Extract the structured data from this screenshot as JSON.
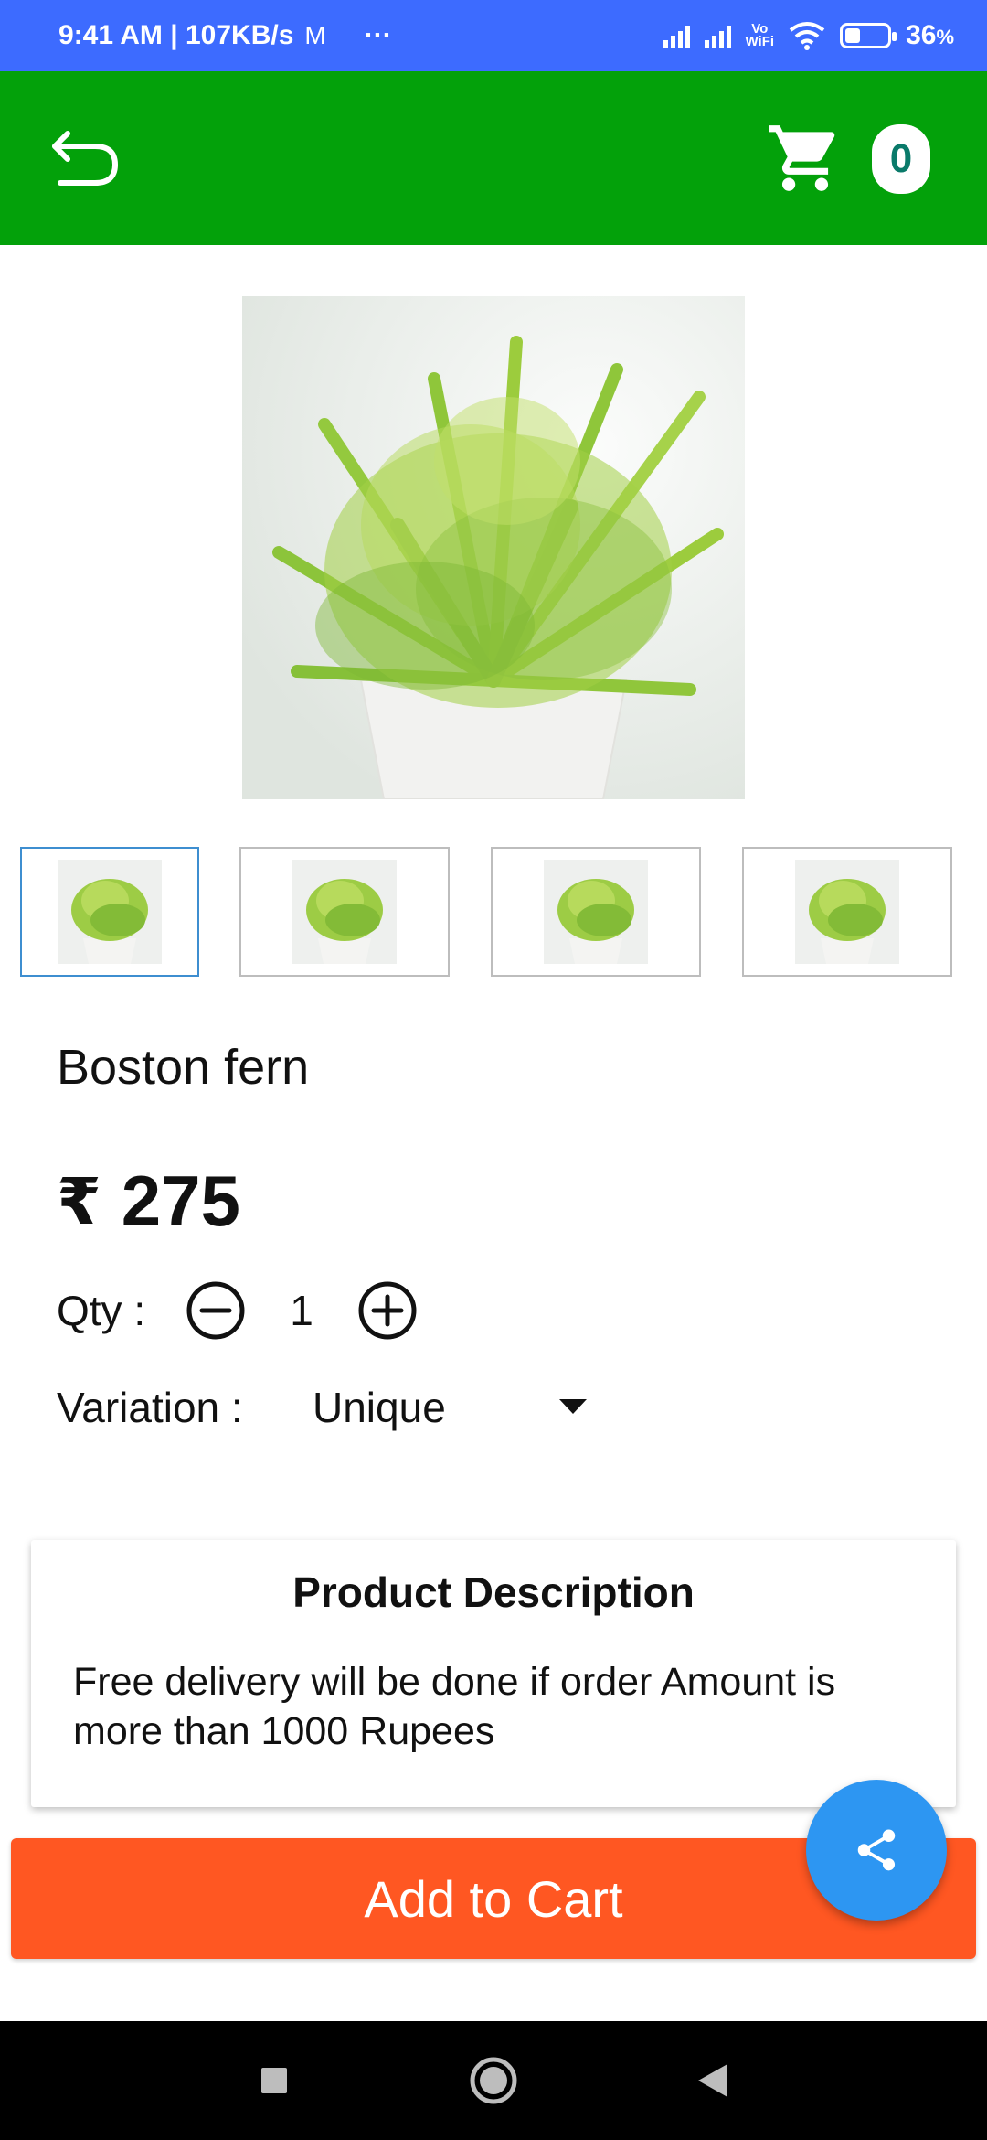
{
  "status_bar": {
    "time_speed": "9:41 AM | 107KB/s",
    "mail_glyph": "M",
    "more": "···",
    "vowifi_top": "Vo",
    "vowifi_bottom": "WiFi",
    "battery": "36",
    "battery_unit": "%",
    "battery_level": 0.36
  },
  "header": {
    "back_icon": "back-arrow-icon",
    "cart_icon": "cart-icon",
    "cart_count": "0"
  },
  "colors": {
    "status_bar": "#3d6bff",
    "app_bar": "#03a10a",
    "add_to_cart": "#ff5722",
    "share_fab": "#2d96f2",
    "thumb_selected_border": "#3e8ed0"
  },
  "gallery": {
    "thumbnails": 4,
    "selected_index": 0
  },
  "product": {
    "name": "Boston fern",
    "currency": "₹",
    "price": "275",
    "qty_label": "Qty :",
    "qty_value": "1",
    "variation_label": "Variation :",
    "variation_value": "Unique"
  },
  "description": {
    "title": "Product Description",
    "text": "Free delivery will be done if order Amount is more than 1000 Rupees"
  },
  "actions": {
    "add_to_cart": "Add to Cart",
    "share_icon": "share-icon"
  },
  "nav": {
    "recents_icon": "square-icon",
    "home_icon": "circle-icon",
    "back_icon": "triangle-back-icon"
  }
}
